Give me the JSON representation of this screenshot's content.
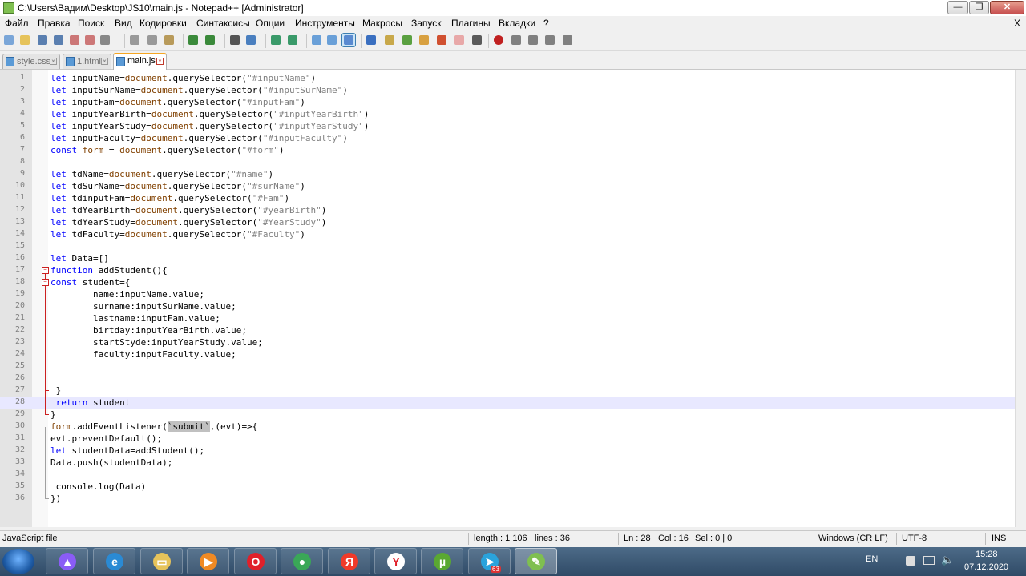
{
  "window": {
    "title": "C:\\Users\\Вадим\\Desktop\\JS10\\main.js - Notepad++ [Administrator]",
    "minimize": "—",
    "maximize": "❐",
    "close": "✕"
  },
  "menu": {
    "items": [
      "Файл",
      "Правка",
      "Поиск",
      "Вид",
      "Кодировки",
      "Синтаксисы",
      "Опции",
      "Инструменты",
      "Макросы",
      "Запуск",
      "Плагины",
      "Вкладки",
      "?"
    ],
    "close": "X"
  },
  "toolbar": {
    "icons": [
      "new-file-icon",
      "open-file-icon",
      "save-icon",
      "save-all-icon",
      "close-icon",
      "close-all-icon",
      "print-icon",
      "cut-icon",
      "copy-icon",
      "paste-icon",
      "undo-icon",
      "redo-icon",
      "find-icon",
      "replace-icon",
      "zoom-in-icon",
      "zoom-out-icon",
      "sync-vertical-icon",
      "sync-horizontal-icon",
      "word-wrap-icon",
      "show-all-chars-icon",
      "indent-guide-icon",
      "user-lang-icon",
      "doc-map-icon",
      "function-list-icon",
      "folder-workspace-icon",
      "monitoring-icon",
      "record-macro-icon",
      "stop-macro-icon",
      "play-macro-icon",
      "run-macro-icon",
      "save-macro-icon"
    ]
  },
  "tabs": [
    {
      "label": "style.css",
      "active": false
    },
    {
      "label": "1.html",
      "active": false
    },
    {
      "label": "main.js",
      "active": true
    }
  ],
  "editor": {
    "lines": [
      "let inputName=document.querySelector(\"#inputName\")",
      "let inputSurName=document.querySelector(\"#inputSurName\")",
      "let inputFam=document.querySelector(\"#inputFam\")",
      "let inputYearBirth=document.querySelector(\"#inputYearBirth\")",
      "let inputYearStudy=document.querySelector(\"#inputYearStudy\")",
      "let inputFaculty=document.querySelector(\"#inputFaculty\")",
      "const form = document.querySelector(\"#form\")",
      "",
      "let tdName=document.querySelector(\"#name\")",
      "let tdSurName=document.querySelector(\"#surName\")",
      "let tdinputFam=document.querySelector(\"#Fam\")",
      "let tdYearBirth=document.querySelector(\"#yearBirth\")",
      "let tdYearStudy=document.querySelector(\"#YearStudy\")",
      "let tdFaculty=document.querySelector(\"#Faculty\")",
      "",
      "let Data=[]",
      "function addStudent(){",
      "const student={",
      "        name:inputName.value;",
      "        surname:inputSurName.value;",
      "        lastname:inputFam.value;",
      "        birtday:inputYearBirth.value;",
      "        startStyde:inputYearStudy.value;",
      "        faculty:inputFaculty.value;",
      "",
      "",
      " }",
      " return student",
      "}",
      "form.addEventListener(`submit`,(evt)=>{",
      "evt.preventDefault();",
      "let studentData=addStudent();",
      "Data.push(studentData);",
      "",
      " console.log(Data)",
      "})"
    ],
    "current_line": 28,
    "highlighted_word": "`submit`"
  },
  "status": {
    "language": "JavaScript file",
    "length": "length : 1 106",
    "lines": "lines : 36",
    "ln": "Ln : 28",
    "col": "Col : 16",
    "sel": "Sel : 0 | 0",
    "eol": "Windows (CR LF)",
    "encoding": "UTF-8",
    "mode": "INS"
  },
  "taskbar": {
    "apps": [
      {
        "name": "alice-icon",
        "glyph": "▲",
        "color": "#8a5cf6",
        "active": false
      },
      {
        "name": "internet-explorer-icon",
        "glyph": "e",
        "color": "#2a8ad4",
        "active": false
      },
      {
        "name": "file-explorer-icon",
        "glyph": "▭",
        "color": "#e6c35a",
        "active": false
      },
      {
        "name": "media-player-icon",
        "glyph": "▶",
        "color": "#f08a24",
        "active": false
      },
      {
        "name": "opera-icon",
        "glyph": "O",
        "color": "#e0202a",
        "active": false
      },
      {
        "name": "chrome-icon",
        "glyph": "●",
        "color": "#3aa757",
        "active": false
      },
      {
        "name": "yandex-icon",
        "glyph": "Я",
        "color": "#f03a2a",
        "active": false
      },
      {
        "name": "yandex-browser-icon",
        "glyph": "Y",
        "color": "#ffffff",
        "active": false
      },
      {
        "name": "utorrent-icon",
        "glyph": "µ",
        "color": "#5aa832",
        "active": false
      },
      {
        "name": "telegram-icon",
        "glyph": "➤",
        "color": "#2aa3dc",
        "active": false
      },
      {
        "name": "notepadpp-icon",
        "glyph": "✎",
        "color": "#7fbf50",
        "active": true
      }
    ],
    "telegram_badge": "63",
    "lang": "EN",
    "time": "15:28",
    "date": "07.12.2020"
  },
  "colors": {
    "keyword": "#0000ff",
    "document": "#804000",
    "string": "#808080",
    "current_line": "#e8e8ff",
    "highlight": "#c0c0c0"
  }
}
